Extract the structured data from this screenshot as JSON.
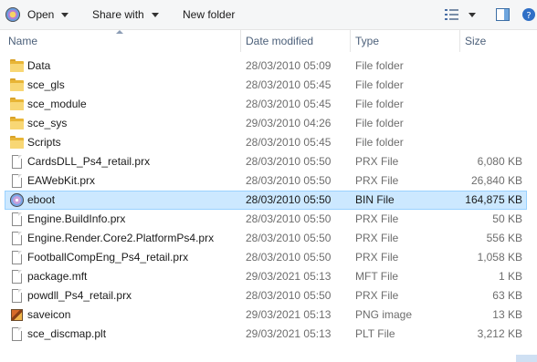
{
  "toolbar": {
    "open_label": "Open",
    "share_label": "Share with",
    "new_folder_label": "New folder",
    "view_icon": "details-view-icon",
    "preview_icon": "preview-pane-icon",
    "help_icon": "help-icon"
  },
  "columns": {
    "name": "Name",
    "date": "Date modified",
    "type": "Type",
    "size": "Size"
  },
  "files": [
    {
      "icon": "folder",
      "name": "Data",
      "date": "28/03/2010 05:09",
      "type": "File folder",
      "size": ""
    },
    {
      "icon": "folder",
      "name": "sce_gls",
      "date": "28/03/2010 05:45",
      "type": "File folder",
      "size": ""
    },
    {
      "icon": "folder",
      "name": "sce_module",
      "date": "28/03/2010 05:45",
      "type": "File folder",
      "size": ""
    },
    {
      "icon": "folder",
      "name": "sce_sys",
      "date": "29/03/2010 04:26",
      "type": "File folder",
      "size": ""
    },
    {
      "icon": "folder",
      "name": "Scripts",
      "date": "28/03/2010 05:45",
      "type": "File folder",
      "size": ""
    },
    {
      "icon": "file",
      "name": "CardsDLL_Ps4_retail.prx",
      "date": "28/03/2010 05:50",
      "type": "PRX File",
      "size": "6,080 KB"
    },
    {
      "icon": "file",
      "name": "EAWebKit.prx",
      "date": "28/03/2010 05:50",
      "type": "PRX File",
      "size": "26,840 KB"
    },
    {
      "icon": "disc",
      "name": "eboot",
      "date": "28/03/2010 05:50",
      "type": "BIN File",
      "size": "164,875 KB",
      "selected": true
    },
    {
      "icon": "file",
      "name": "Engine.BuildInfo.prx",
      "date": "28/03/2010 05:50",
      "type": "PRX File",
      "size": "50 KB"
    },
    {
      "icon": "file",
      "name": "Engine.Render.Core2.PlatformPs4.prx",
      "date": "28/03/2010 05:50",
      "type": "PRX File",
      "size": "556 KB"
    },
    {
      "icon": "file",
      "name": "FootballCompEng_Ps4_retail.prx",
      "date": "28/03/2010 05:50",
      "type": "PRX File",
      "size": "1,058 KB"
    },
    {
      "icon": "file",
      "name": "package.mft",
      "date": "29/03/2021 05:13",
      "type": "MFT File",
      "size": "1 KB"
    },
    {
      "icon": "file",
      "name": "powdll_Ps4_retail.prx",
      "date": "28/03/2010 05:50",
      "type": "PRX File",
      "size": "63 KB"
    },
    {
      "icon": "image",
      "name": "saveicon",
      "date": "29/03/2021 05:13",
      "type": "PNG image",
      "size": "13 KB"
    },
    {
      "icon": "file",
      "name": "sce_discmap.plt",
      "date": "29/03/2021 05:13",
      "type": "PLT File",
      "size": "3,212 KB"
    }
  ]
}
